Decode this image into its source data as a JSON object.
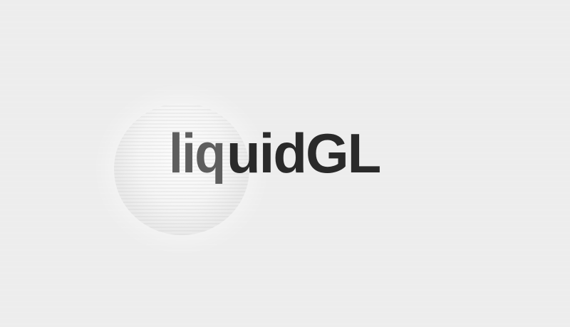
{
  "logo": {
    "refracted_part": "liq",
    "plain_part": "uidGL"
  },
  "colors": {
    "background": "#ededed",
    "text": "#2a2a2a",
    "refracted_text": "#5e5e5e"
  }
}
